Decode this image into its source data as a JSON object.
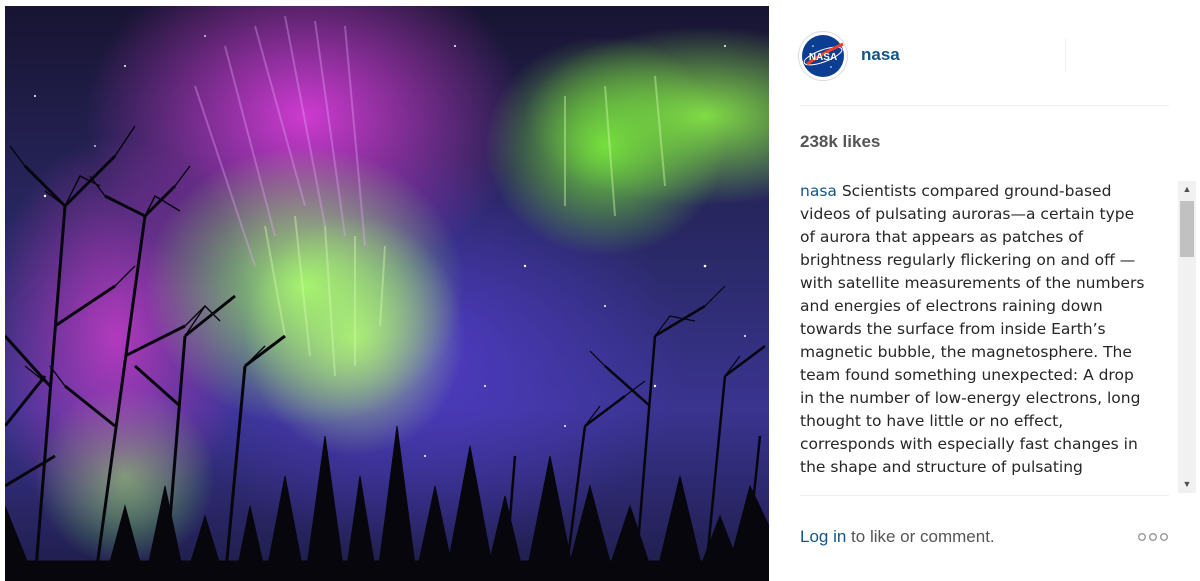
{
  "post": {
    "photo_alt": "Aurora over forest",
    "author": {
      "username": "nasa",
      "avatar_icon": "nasa-logo-icon"
    },
    "likes": "238k likes",
    "caption": {
      "username": "nasa",
      "text": "Scientists compared ground-based videos of pulsating auroras—a certain type of aurora that appears as patches of brightness regularly flickering on and off —with satellite measurements of the numbers and energies of electrons raining down towards the surface from inside Earth’s magnetic bubble, the magnetosphere. The team found something unexpected: A drop in the number of low-energy electrons, long thought to have little or no effect, corresponds with especially fast changes in the shape and structure of pulsating"
    },
    "footer": {
      "login_link": "Log in",
      "login_rest": " to like or comment.",
      "more_icon": "more-options-icon"
    }
  },
  "colors": {
    "link_blue": "#125688",
    "text_gray": "#555555",
    "nasa_blue": "#0b3d91",
    "nasa_red": "#fc3d21"
  }
}
